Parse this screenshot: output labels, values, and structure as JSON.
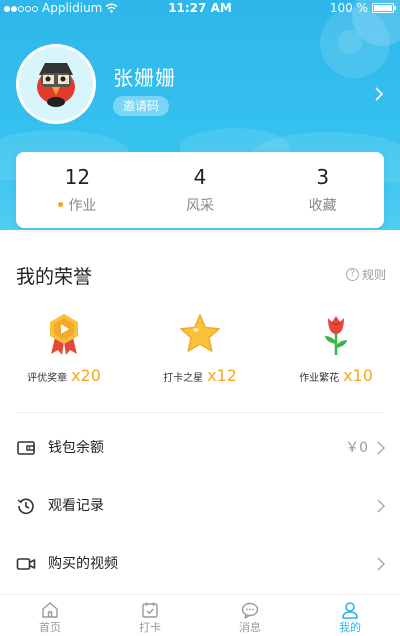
{
  "status_bar": {
    "carrier": "Applidium",
    "time": "11:27 AM",
    "battery": "100 %"
  },
  "profile": {
    "name": "张姗姗",
    "invite_code_label": "邀请码",
    "avatar_icon": "penguin-avatar-icon"
  },
  "stats": [
    {
      "value": "12",
      "label": "作业",
      "has_dot": true
    },
    {
      "value": "4",
      "label": "风采",
      "has_dot": false
    },
    {
      "value": "3",
      "label": "收藏",
      "has_dot": false
    }
  ],
  "honors": {
    "title": "我的荣誉",
    "rules_label": "规则",
    "items": [
      {
        "icon": "medal-icon",
        "label": "评优奖章",
        "count": "x20"
      },
      {
        "icon": "star-icon",
        "label": "打卡之星",
        "count": "x12"
      },
      {
        "icon": "rose-icon",
        "label": "作业繁花",
        "count": "x10"
      }
    ]
  },
  "menu": [
    {
      "icon": "wallet-icon",
      "label": "钱包余额",
      "value": "￥0"
    },
    {
      "icon": "history-icon",
      "label": "观看记录",
      "value": ""
    },
    {
      "icon": "video-icon",
      "label": "购买的视频",
      "value": ""
    }
  ],
  "tabbar": [
    {
      "icon": "home-icon",
      "label": "首页",
      "active": false
    },
    {
      "icon": "calendar-check-icon",
      "label": "打卡",
      "active": false
    },
    {
      "icon": "message-icon",
      "label": "消息",
      "active": false
    },
    {
      "icon": "user-icon",
      "label": "我的",
      "active": true
    }
  ],
  "colors": {
    "header": "#2fb6ea",
    "accent": "#29b6ef",
    "count": "#f5a623"
  }
}
